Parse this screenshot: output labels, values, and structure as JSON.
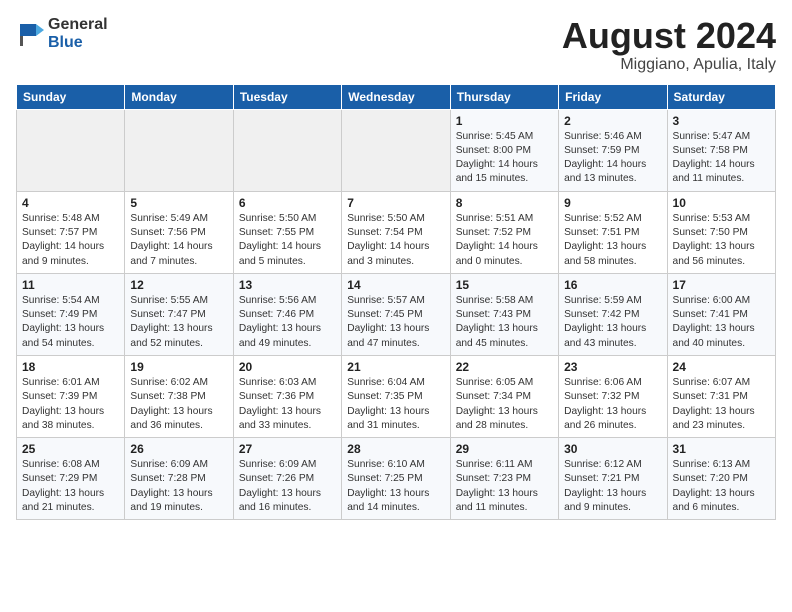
{
  "header": {
    "logo_general": "General",
    "logo_blue": "Blue",
    "title": "August 2024",
    "subtitle": "Miggiano, Apulia, Italy"
  },
  "weekdays": [
    "Sunday",
    "Monday",
    "Tuesday",
    "Wednesday",
    "Thursday",
    "Friday",
    "Saturday"
  ],
  "weeks": [
    [
      {
        "day": "",
        "info": ""
      },
      {
        "day": "",
        "info": ""
      },
      {
        "day": "",
        "info": ""
      },
      {
        "day": "",
        "info": ""
      },
      {
        "day": "1",
        "info": "Sunrise: 5:45 AM\nSunset: 8:00 PM\nDaylight: 14 hours\nand 15 minutes."
      },
      {
        "day": "2",
        "info": "Sunrise: 5:46 AM\nSunset: 7:59 PM\nDaylight: 14 hours\nand 13 minutes."
      },
      {
        "day": "3",
        "info": "Sunrise: 5:47 AM\nSunset: 7:58 PM\nDaylight: 14 hours\nand 11 minutes."
      }
    ],
    [
      {
        "day": "4",
        "info": "Sunrise: 5:48 AM\nSunset: 7:57 PM\nDaylight: 14 hours\nand 9 minutes."
      },
      {
        "day": "5",
        "info": "Sunrise: 5:49 AM\nSunset: 7:56 PM\nDaylight: 14 hours\nand 7 minutes."
      },
      {
        "day": "6",
        "info": "Sunrise: 5:50 AM\nSunset: 7:55 PM\nDaylight: 14 hours\nand 5 minutes."
      },
      {
        "day": "7",
        "info": "Sunrise: 5:50 AM\nSunset: 7:54 PM\nDaylight: 14 hours\nand 3 minutes."
      },
      {
        "day": "8",
        "info": "Sunrise: 5:51 AM\nSunset: 7:52 PM\nDaylight: 14 hours\nand 0 minutes."
      },
      {
        "day": "9",
        "info": "Sunrise: 5:52 AM\nSunset: 7:51 PM\nDaylight: 13 hours\nand 58 minutes."
      },
      {
        "day": "10",
        "info": "Sunrise: 5:53 AM\nSunset: 7:50 PM\nDaylight: 13 hours\nand 56 minutes."
      }
    ],
    [
      {
        "day": "11",
        "info": "Sunrise: 5:54 AM\nSunset: 7:49 PM\nDaylight: 13 hours\nand 54 minutes."
      },
      {
        "day": "12",
        "info": "Sunrise: 5:55 AM\nSunset: 7:47 PM\nDaylight: 13 hours\nand 52 minutes."
      },
      {
        "day": "13",
        "info": "Sunrise: 5:56 AM\nSunset: 7:46 PM\nDaylight: 13 hours\nand 49 minutes."
      },
      {
        "day": "14",
        "info": "Sunrise: 5:57 AM\nSunset: 7:45 PM\nDaylight: 13 hours\nand 47 minutes."
      },
      {
        "day": "15",
        "info": "Sunrise: 5:58 AM\nSunset: 7:43 PM\nDaylight: 13 hours\nand 45 minutes."
      },
      {
        "day": "16",
        "info": "Sunrise: 5:59 AM\nSunset: 7:42 PM\nDaylight: 13 hours\nand 43 minutes."
      },
      {
        "day": "17",
        "info": "Sunrise: 6:00 AM\nSunset: 7:41 PM\nDaylight: 13 hours\nand 40 minutes."
      }
    ],
    [
      {
        "day": "18",
        "info": "Sunrise: 6:01 AM\nSunset: 7:39 PM\nDaylight: 13 hours\nand 38 minutes."
      },
      {
        "day": "19",
        "info": "Sunrise: 6:02 AM\nSunset: 7:38 PM\nDaylight: 13 hours\nand 36 minutes."
      },
      {
        "day": "20",
        "info": "Sunrise: 6:03 AM\nSunset: 7:36 PM\nDaylight: 13 hours\nand 33 minutes."
      },
      {
        "day": "21",
        "info": "Sunrise: 6:04 AM\nSunset: 7:35 PM\nDaylight: 13 hours\nand 31 minutes."
      },
      {
        "day": "22",
        "info": "Sunrise: 6:05 AM\nSunset: 7:34 PM\nDaylight: 13 hours\nand 28 minutes."
      },
      {
        "day": "23",
        "info": "Sunrise: 6:06 AM\nSunset: 7:32 PM\nDaylight: 13 hours\nand 26 minutes."
      },
      {
        "day": "24",
        "info": "Sunrise: 6:07 AM\nSunset: 7:31 PM\nDaylight: 13 hours\nand 23 minutes."
      }
    ],
    [
      {
        "day": "25",
        "info": "Sunrise: 6:08 AM\nSunset: 7:29 PM\nDaylight: 13 hours\nand 21 minutes."
      },
      {
        "day": "26",
        "info": "Sunrise: 6:09 AM\nSunset: 7:28 PM\nDaylight: 13 hours\nand 19 minutes."
      },
      {
        "day": "27",
        "info": "Sunrise: 6:09 AM\nSunset: 7:26 PM\nDaylight: 13 hours\nand 16 minutes."
      },
      {
        "day": "28",
        "info": "Sunrise: 6:10 AM\nSunset: 7:25 PM\nDaylight: 13 hours\nand 14 minutes."
      },
      {
        "day": "29",
        "info": "Sunrise: 6:11 AM\nSunset: 7:23 PM\nDaylight: 13 hours\nand 11 minutes."
      },
      {
        "day": "30",
        "info": "Sunrise: 6:12 AM\nSunset: 7:21 PM\nDaylight: 13 hours\nand 9 minutes."
      },
      {
        "day": "31",
        "info": "Sunrise: 6:13 AM\nSunset: 7:20 PM\nDaylight: 13 hours\nand 6 minutes."
      }
    ]
  ]
}
